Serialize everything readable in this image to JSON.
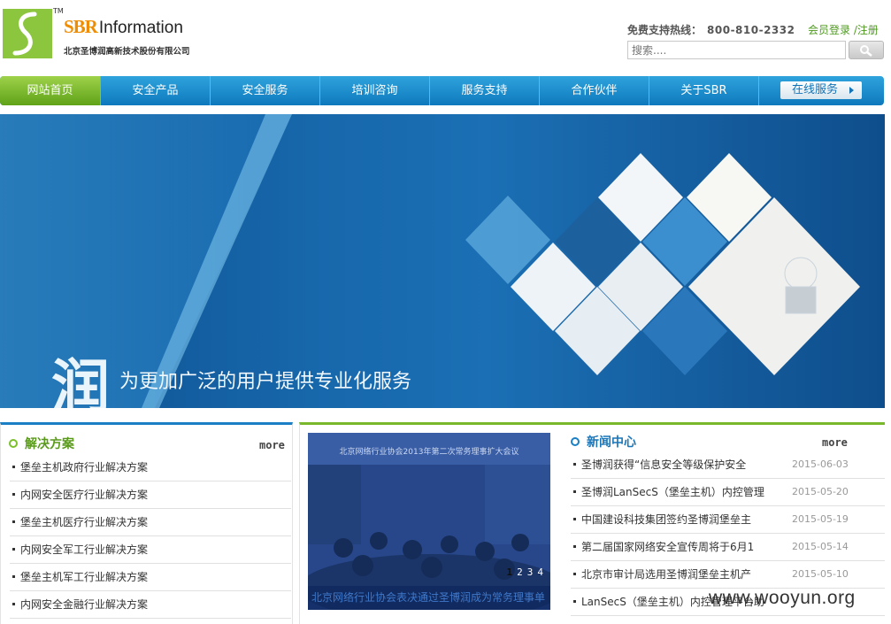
{
  "header": {
    "tm": "TM",
    "brand_sbr": "SBR",
    "brand_info": "Information",
    "company": "北京圣博润高新技术股份有限公司",
    "hotline_label": "免费支持热线：",
    "hotline_number": "800-810-2332",
    "login_label": "会员登录",
    "register_label": "/注册",
    "search_placeholder": "搜索....",
    "logo_color": "#8cc63f",
    "brand_color": "#f08c00"
  },
  "nav": {
    "items": [
      {
        "label": "网站首页",
        "active": true
      },
      {
        "label": "安全产品"
      },
      {
        "label": "安全服务"
      },
      {
        "label": "培训咨询"
      },
      {
        "label": "服务支持"
      },
      {
        "label": "合作伙伴"
      },
      {
        "label": "关于SBR"
      }
    ],
    "online_service": "在线服务",
    "active_color": "#7dbd2c",
    "bar_color": "#1a8bcf"
  },
  "banner": {
    "char": "润",
    "slogan": "为更加广泛的用户提供专业化服务"
  },
  "solutions": {
    "title": "解决方案",
    "more": "more",
    "items": [
      "堡垒主机政府行业解决方案",
      "内网安全医疗行业解决方案",
      "堡垒主机医疗行业解决方案",
      "内网安全军工行业解决方案",
      "堡垒主机军工行业解决方案",
      "内网安全金融行业解决方案"
    ]
  },
  "slideshow": {
    "caption": "北京网络行业协会表决通过圣博润成为常务理事单",
    "banner_text": "北京网络行业协会2013年第二次常务理事扩大会议",
    "pages": [
      "1",
      "2",
      "3",
      "4"
    ],
    "current_page": 1
  },
  "news": {
    "title": "新闻中心",
    "more": "more",
    "items": [
      {
        "title": "圣博润获得“信息安全等级保护安全",
        "date": "2015-06-03"
      },
      {
        "title": "圣博润LanSecS（堡垒主机）内控管理",
        "date": "2015-05-20"
      },
      {
        "title": "中国建设科技集团签约圣博润堡垒主",
        "date": "2015-05-19"
      },
      {
        "title": "第二届国家网络安全宣传周将于6月1",
        "date": "2015-05-14"
      },
      {
        "title": "北京市审计局选用圣博润堡垒主机产",
        "date": "2015-05-10"
      },
      {
        "title": "LanSecS（堡垒主机）内控管理平台助",
        "date": ""
      }
    ]
  },
  "watermark": "www.wooyun.org"
}
